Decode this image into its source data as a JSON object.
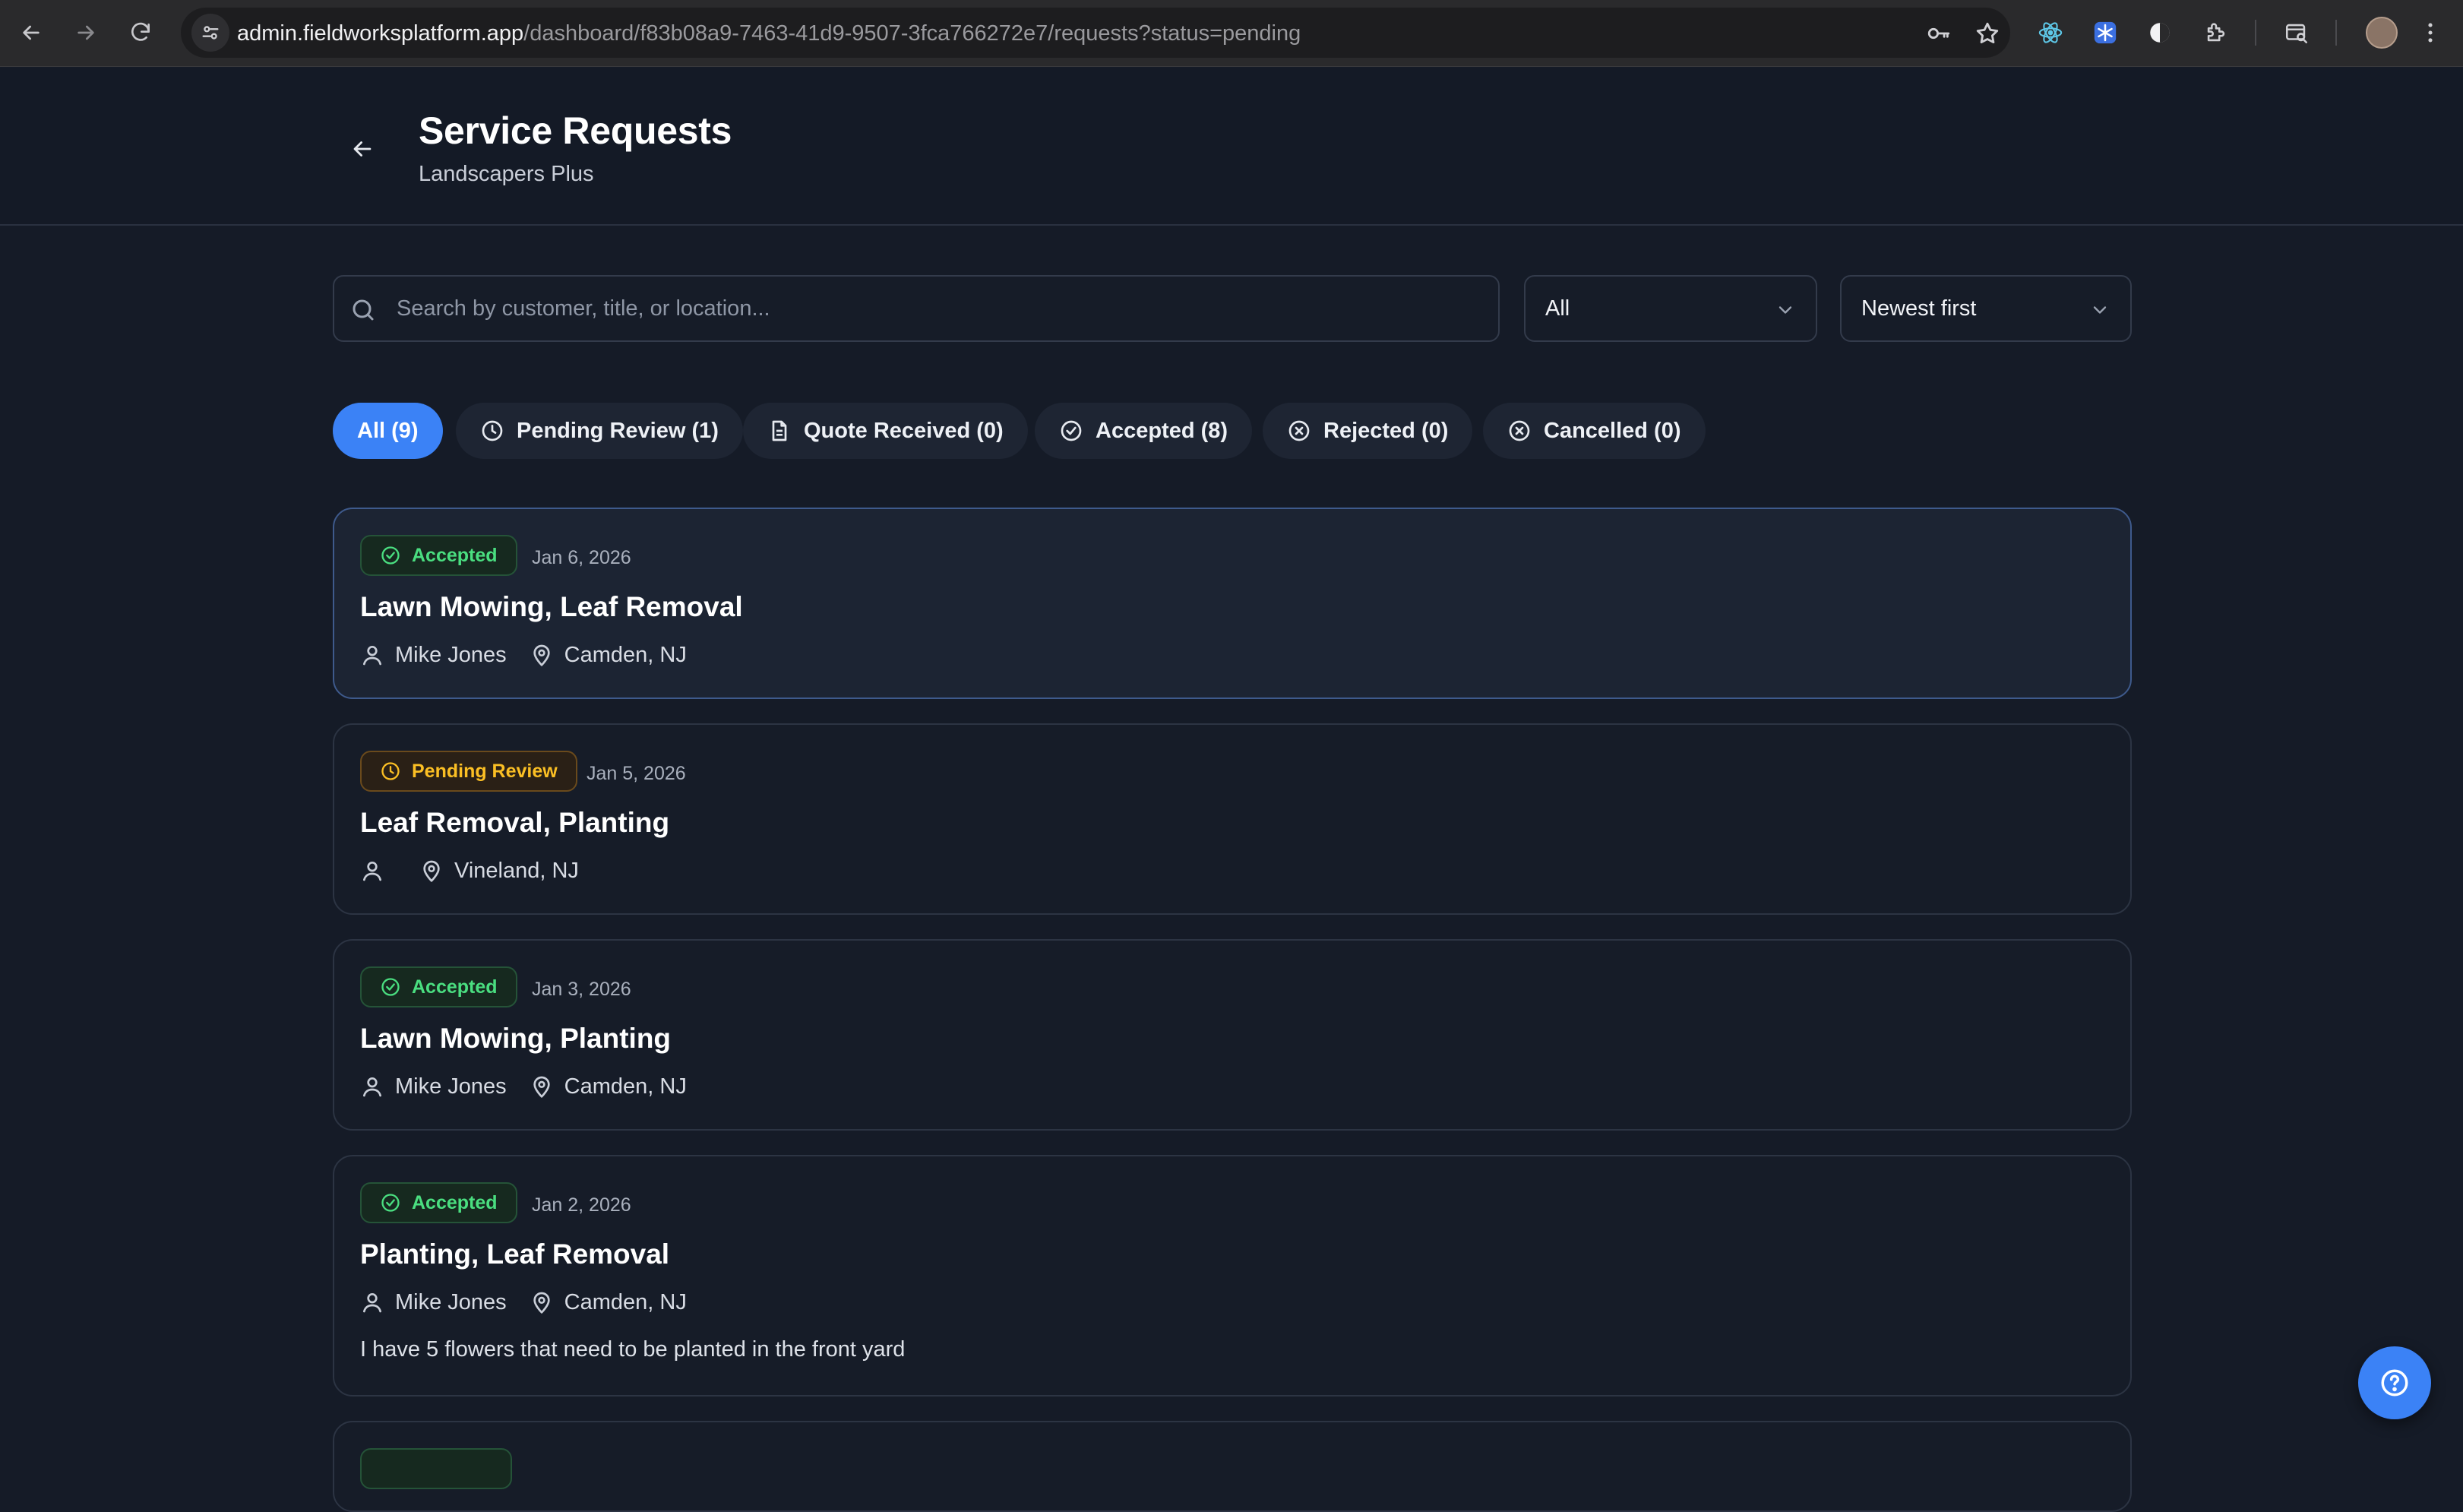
{
  "browser": {
    "url_host": "admin.fieldworksplatform.app",
    "url_path": "/dashboard/f83b08a9-7463-41d9-9507-3fca766272e7/requests?status=pending"
  },
  "header": {
    "title": "Service Requests",
    "subtitle": "Landscapers Plus"
  },
  "filters": {
    "search_placeholder": "Search by customer, title, or location...",
    "status_select": "All",
    "sort_select": "Newest first"
  },
  "tabs": [
    {
      "label": "All (9)",
      "icon": "none",
      "active": true
    },
    {
      "label": "Pending Review (1)",
      "icon": "clock-icon",
      "active": false
    },
    {
      "label": "Quote Received (0)",
      "icon": "document-icon",
      "active": false
    },
    {
      "label": "Accepted (8)",
      "icon": "check-circle-icon",
      "active": false
    },
    {
      "label": "Rejected (0)",
      "icon": "x-circle-icon",
      "active": false
    },
    {
      "label": "Cancelled (0)",
      "icon": "x-circle-icon",
      "active": false
    }
  ],
  "requests": [
    {
      "status": "Accepted",
      "date": "Jan 6, 2026",
      "title": "Lawn Mowing, Leaf Removal",
      "customer": "Mike Jones",
      "location": "Camden, NJ",
      "description": ""
    },
    {
      "status": "Pending Review",
      "date": "Jan 5, 2026",
      "title": "Leaf Removal, Planting",
      "customer": "",
      "location": "Vineland, NJ",
      "description": ""
    },
    {
      "status": "Accepted",
      "date": "Jan 3, 2026",
      "title": "Lawn Mowing, Planting",
      "customer": "Mike Jones",
      "location": "Camden, NJ",
      "description": ""
    },
    {
      "status": "Accepted",
      "date": "Jan 2, 2026",
      "title": "Planting, Leaf Removal",
      "customer": "Mike Jones",
      "location": "Camden, NJ",
      "description": "I have 5 flowers that need to be planted in the front yard"
    }
  ],
  "colors": {
    "accent": "#3b82f6",
    "accepted": "#4ade80",
    "pending": "#fbbf24",
    "background": "#151b27"
  }
}
